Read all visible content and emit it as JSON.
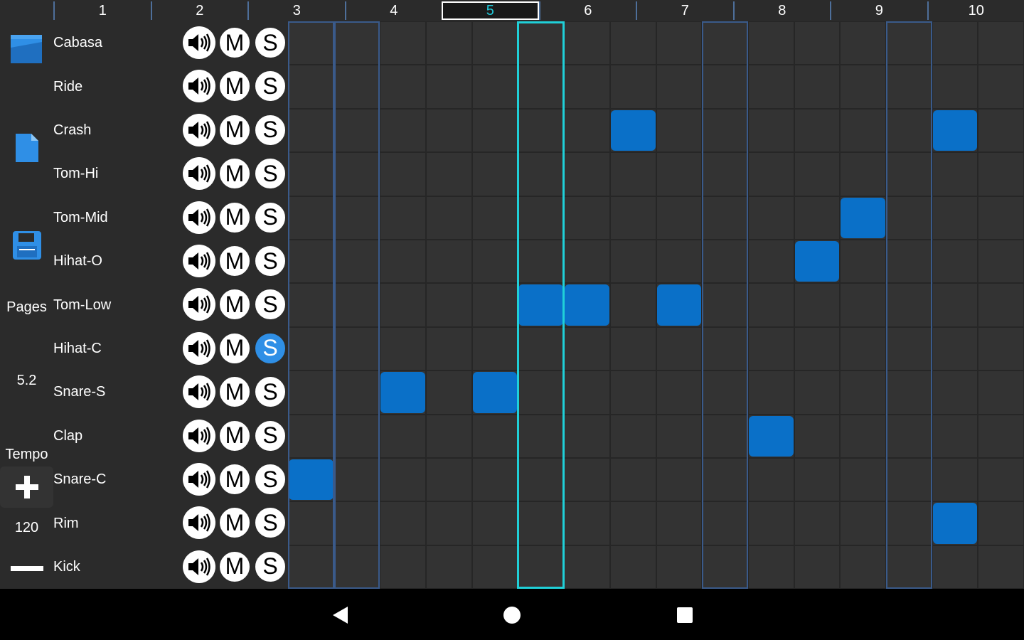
{
  "left_panel": {
    "pages_label": "Pages",
    "pages_value": "5.2",
    "tempo_label": "Tempo",
    "tempo_value": "120",
    "icons": [
      "open-file-icon",
      "new-file-icon",
      "save-icon",
      "plus-icon",
      "minus-icon"
    ]
  },
  "ruler": {
    "labels": [
      "1",
      "2",
      "3",
      "4",
      "5",
      "6",
      "7",
      "8",
      "9",
      "10"
    ],
    "current": "5"
  },
  "tracks": [
    {
      "name": "Cabasa",
      "mute": "M",
      "solo": "S",
      "solo_active": false
    },
    {
      "name": "Ride",
      "mute": "M",
      "solo": "S",
      "solo_active": false
    },
    {
      "name": "Crash",
      "mute": "M",
      "solo": "S",
      "solo_active": false
    },
    {
      "name": "Tom-Hi",
      "mute": "M",
      "solo": "S",
      "solo_active": false
    },
    {
      "name": "Tom-Mid",
      "mute": "M",
      "solo": "S",
      "solo_active": false
    },
    {
      "name": "Hihat-O",
      "mute": "M",
      "solo": "S",
      "solo_active": false
    },
    {
      "name": "Tom-Low",
      "mute": "M",
      "solo": "S",
      "solo_active": false
    },
    {
      "name": "Hihat-C",
      "mute": "M",
      "solo": "S",
      "solo_active": true
    },
    {
      "name": "Snare-S",
      "mute": "M",
      "solo": "S",
      "solo_active": false
    },
    {
      "name": "Clap",
      "mute": "M",
      "solo": "S",
      "solo_active": false
    },
    {
      "name": "Snare-C",
      "mute": "M",
      "solo": "S",
      "solo_active": false
    },
    {
      "name": "Rim",
      "mute": "M",
      "solo": "S",
      "solo_active": false
    },
    {
      "name": "Kick",
      "mute": "M",
      "solo": "S",
      "solo_active": false
    }
  ],
  "grid": {
    "steps": 16,
    "playhead_step": 5,
    "beat_frame_steps": [
      1,
      9,
      13
    ],
    "notes": [
      {
        "track": "Crash",
        "step": 7
      },
      {
        "track": "Crash",
        "step": 14
      },
      {
        "track": "Tom-Mid",
        "step": 12
      },
      {
        "track": "Hihat-O",
        "step": 11
      },
      {
        "track": "Tom-Low",
        "step": 5
      },
      {
        "track": "Tom-Low",
        "step": 6
      },
      {
        "track": "Tom-Low",
        "step": 8
      },
      {
        "track": "Snare-S",
        "step": 2
      },
      {
        "track": "Snare-S",
        "step": 4
      },
      {
        "track": "Clap",
        "step": 10
      },
      {
        "track": "Snare-C",
        "step": 0
      },
      {
        "track": "Rim",
        "step": 14
      }
    ]
  },
  "colors": {
    "note": "#0a70c8",
    "solo_active": "#2f8fe6",
    "playhead": "#20d0d8",
    "frame": "#3a5a8a"
  },
  "navbar": {
    "icons": [
      "back-icon",
      "home-icon",
      "recents-icon"
    ]
  }
}
